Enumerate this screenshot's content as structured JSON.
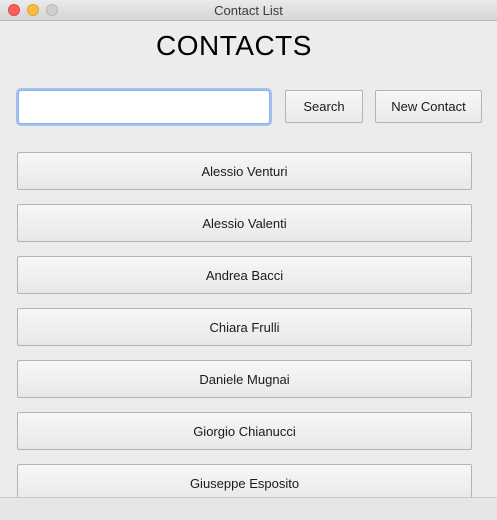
{
  "window": {
    "title": "Contact List"
  },
  "header": {
    "title": "CONTACTS"
  },
  "search": {
    "value": "",
    "placeholder": ""
  },
  "toolbar": {
    "search_label": "Search",
    "new_contact_label": "New Contact"
  },
  "contacts": [
    "Alessio Venturi",
    "Alessio Valenti",
    "Andrea Bacci",
    "Chiara Frulli",
    "Daniele Mugnai",
    "Giorgio Chianucci",
    "Giuseppe Esposito"
  ]
}
